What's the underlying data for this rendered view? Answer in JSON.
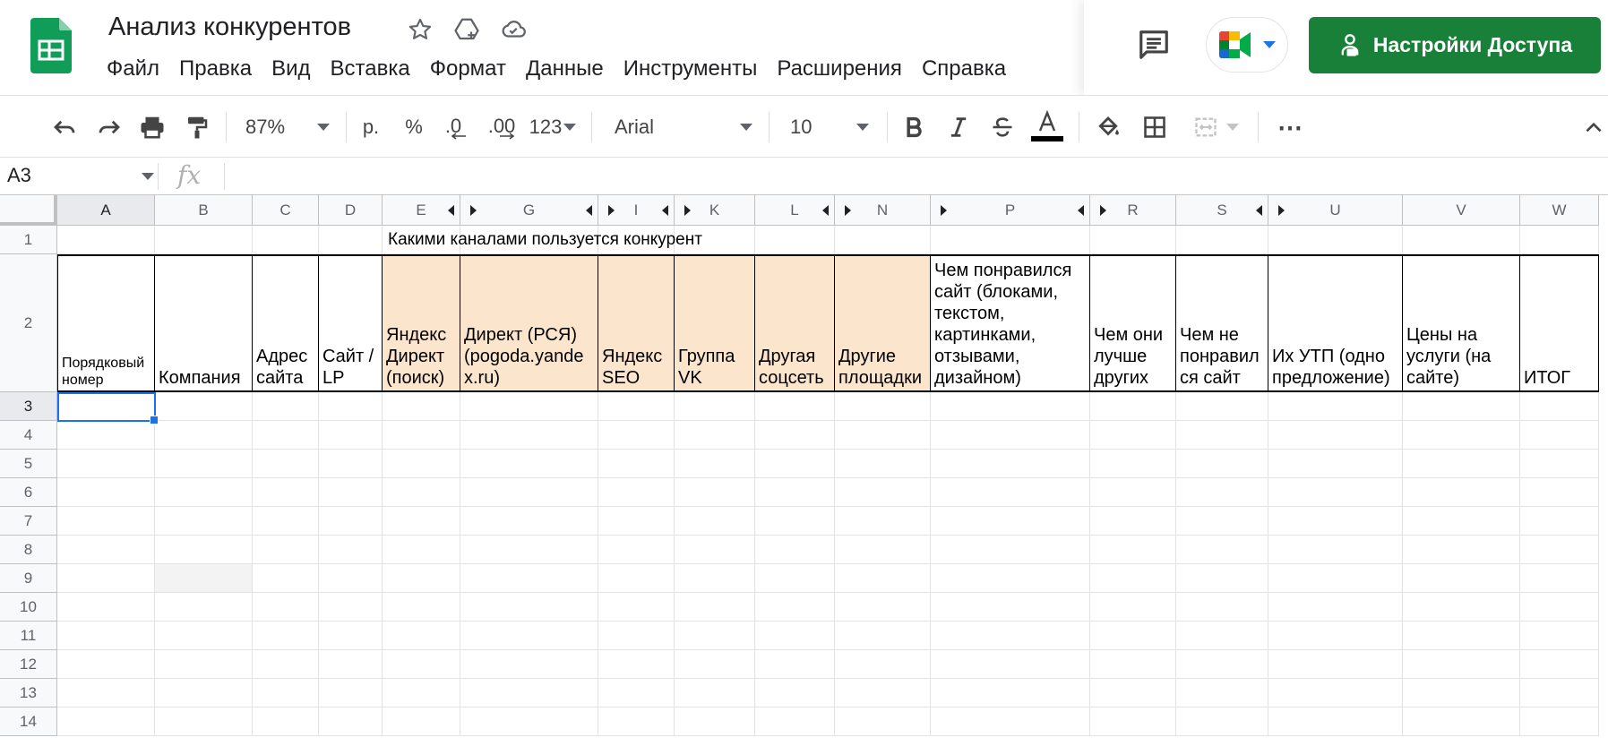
{
  "header": {
    "doc_title": "Анализ конкурентов",
    "menu": [
      "Файл",
      "Правка",
      "Вид",
      "Вставка",
      "Формат",
      "Данные",
      "Инструменты",
      "Расширения",
      "Справка"
    ],
    "share_label": "Настройки Доступа",
    "colors": {
      "brand_green": "#188038",
      "sheets_green": "#0f9d58"
    }
  },
  "toolbar": {
    "zoom": "87%",
    "currency": "р.",
    "percent": "%",
    "dec_decrease": ".0",
    "dec_increase": ".00",
    "number_format": "123",
    "font": "Arial",
    "font_size": "10",
    "more": "⋯"
  },
  "formula": {
    "name_box": "A3",
    "fx": "fx",
    "value": ""
  },
  "sheet": {
    "columns": [
      "A",
      "B",
      "C",
      "D",
      "E",
      "G",
      "I",
      "K",
      "L",
      "N",
      "P",
      "R",
      "S",
      "U",
      "V",
      "W"
    ],
    "rows": [
      "1",
      "2",
      "3",
      "4",
      "5",
      "6",
      "7",
      "8",
      "9",
      "10",
      "11",
      "12",
      "13",
      "14"
    ],
    "merged_title": "Какими каналами пользуется конкурент",
    "headers": [
      "Порядковый\nномер",
      "Компания",
      "Адрес\nсайта",
      "Сайт /\nLP",
      "Яндекс\nДирект\n(поиск)",
      "Директ (РСЯ)\n(pogoda.yande\nx.ru)",
      "Яндекс\nSEO",
      "Группа\nVK",
      "Другая\nсоцсеть",
      "Другие\nплощадки",
      "Чем понравился\nсайт (блоками,\nтекстом,\nкартинками,\nотзывами,\nдизайном)",
      "Чем они\nлучше\nдругих",
      "Чем не\nпонравил\nся сайт",
      "Их УТП (одно\nпредложение)",
      "Цены на\nуслуги (на\nсайте)",
      "ИТОГ"
    ],
    "highlight_color": "#fce5cd",
    "selection_color": "#1a73e8"
  }
}
